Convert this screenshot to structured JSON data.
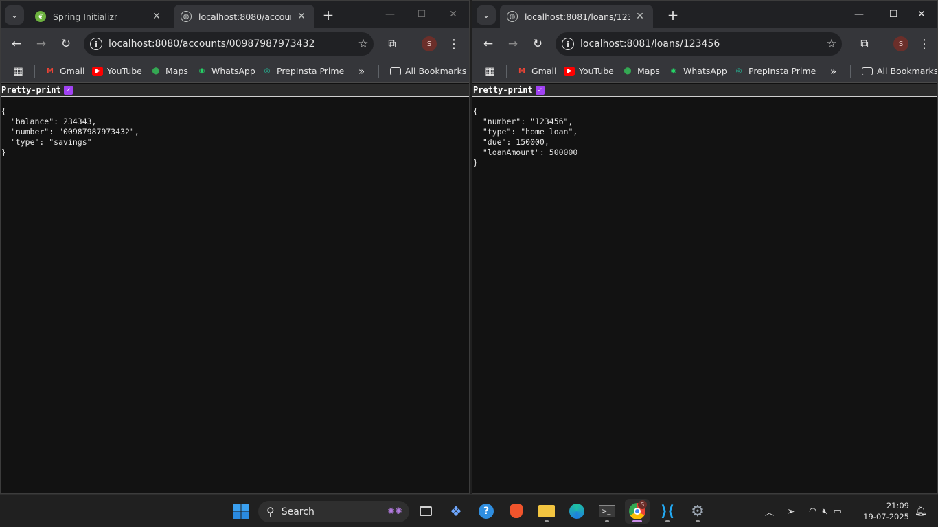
{
  "left_window": {
    "tabs": [
      {
        "title": "Spring Initializr",
        "active": false
      },
      {
        "title": "localhost:8080/accounts/00987987973432",
        "active": true
      }
    ],
    "url": "localhost:8080/accounts/00987987973432",
    "pretty_print_label": "Pretty-print",
    "json_text": "{\n  \"balance\": 234343,\n  \"number\": \"00987987973432\",\n  \"type\": \"savings\"\n}"
  },
  "right_window": {
    "tabs": [
      {
        "title": "localhost:8081/loans/123456",
        "active": true
      }
    ],
    "url": "localhost:8081/loans/123456",
    "pretty_print_label": "Pretty-print",
    "json_text": "{\n  \"number\": \"123456\",\n  \"type\": \"home loan\",\n  \"due\": 150000,\n  \"loanAmount\": 500000\n}"
  },
  "bookmarks": [
    {
      "label": "Gmail",
      "icon": "gmail-icon"
    },
    {
      "label": "YouTube",
      "icon": "youtube-icon"
    },
    {
      "label": "Maps",
      "icon": "maps-icon"
    },
    {
      "label": "WhatsApp",
      "icon": "whatsapp-icon"
    },
    {
      "label": "PrepInsta Prime",
      "icon": "prepinsta-icon"
    }
  ],
  "all_bookmarks_label": "All Bookmarks",
  "profile_initial": "S",
  "taskbar": {
    "search_label": "Search",
    "clock_time": "21:09",
    "clock_date": "19-07-2025",
    "chrome_badge": "S"
  },
  "colors": {
    "tab_strip": "#202124",
    "toolbar": "#35363a",
    "page_bg": "#121212",
    "pretty_print_check": "#a142f4"
  }
}
